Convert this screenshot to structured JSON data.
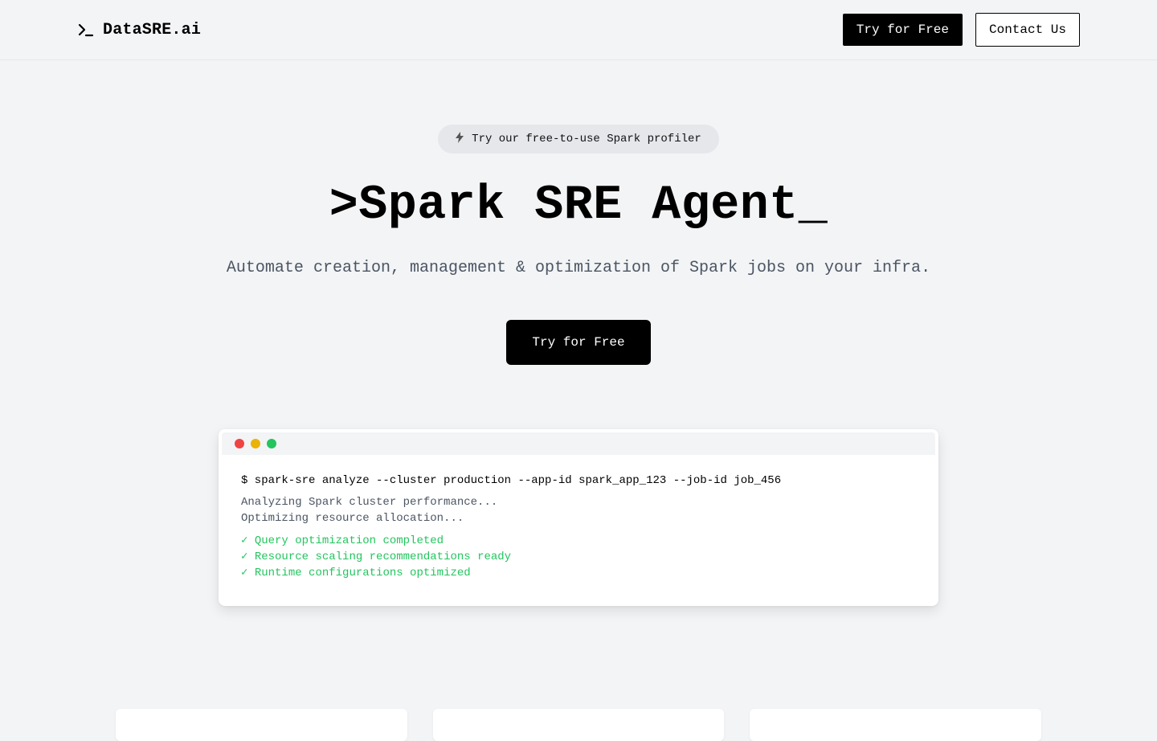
{
  "header": {
    "logo_text": "DataSRE.ai",
    "try_free_label": "Try for Free",
    "contact_label": "Contact Us"
  },
  "hero": {
    "pill_icon": "spark-icon",
    "pill_text": "Try our free-to-use Spark profiler",
    "title": ">Spark SRE Agent_",
    "subtitle": "Automate creation, management & optimization of Spark jobs on your infra.",
    "cta_label": "Try for Free"
  },
  "terminal": {
    "dot_colors": [
      "#ef4444",
      "#eab308",
      "#22c55e"
    ],
    "command": "$ spark-sre analyze --cluster production --app-id spark_app_123 --job-id job_456",
    "progress_lines": [
      "Analyzing Spark cluster performance...",
      "Optimizing resource allocation..."
    ],
    "success_lines": [
      "✓ Query optimization completed",
      "✓ Resource scaling recommendations ready",
      "✓ Runtime configurations optimized"
    ]
  },
  "colors": {
    "background": "#f3f4f6",
    "primary": "#000000",
    "success": "#22c55e",
    "muted_text": "#4b5563"
  }
}
